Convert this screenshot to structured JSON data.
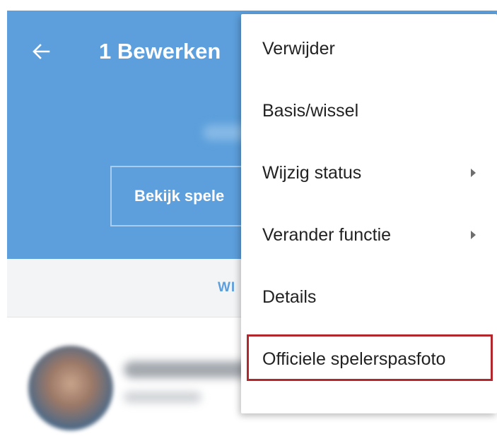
{
  "appbar": {
    "title": "1 Bewerken",
    "back_icon": "arrow-left-icon",
    "view_button_label": "Bekijk spele",
    "color": "#5c9fdc"
  },
  "tabs": {
    "visible_label": "WI"
  },
  "menu": {
    "items": [
      {
        "label": "Verwijder",
        "has_submenu": false
      },
      {
        "label": "Basis/wissel",
        "has_submenu": false
      },
      {
        "label": "Wijzig status",
        "has_submenu": true
      },
      {
        "label": "Verander functie",
        "has_submenu": true
      },
      {
        "label": "Details",
        "has_submenu": false
      },
      {
        "label": "Officiele spelerspasfoto",
        "has_submenu": false
      }
    ],
    "highlighted_item": "Officiele spelerspasfoto",
    "highlight_color": "#b3262b"
  }
}
